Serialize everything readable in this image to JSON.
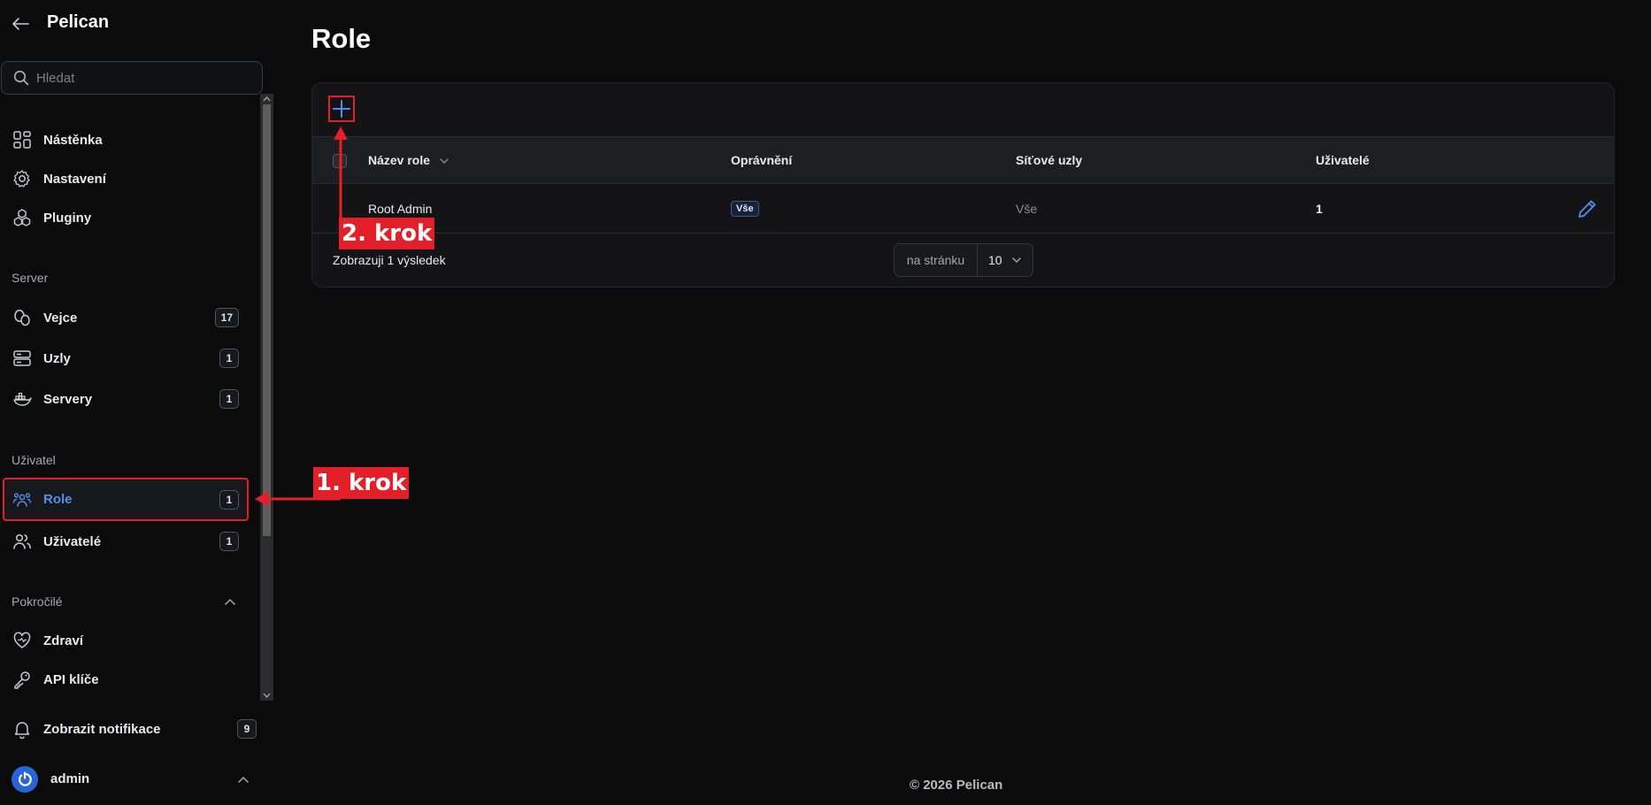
{
  "app": {
    "name": "Pelican"
  },
  "search": {
    "placeholder": "Hledat"
  },
  "nav": {
    "top": [
      {
        "label": "Nástěnka",
        "icon": "dashboard-icon"
      },
      {
        "label": "Nastavení",
        "icon": "gear-icon"
      },
      {
        "label": "Pluginy",
        "icon": "plugins-icon"
      }
    ],
    "server_section": "Server",
    "server": [
      {
        "label": "Vejce",
        "icon": "eggs-icon",
        "badge": "17"
      },
      {
        "label": "Uzly",
        "icon": "server-stack-icon",
        "badge": "1"
      },
      {
        "label": "Servery",
        "icon": "docker-icon",
        "badge": "1"
      }
    ],
    "user_section": "Uživatel",
    "user": [
      {
        "label": "Role",
        "icon": "users-group-icon",
        "badge": "1",
        "active": true
      },
      {
        "label": "Uživatelé",
        "icon": "users-icon",
        "badge": "1"
      }
    ],
    "advanced_section": "Pokročilé",
    "advanced": [
      {
        "label": "Zdraví",
        "icon": "heart-icon"
      },
      {
        "label": "API klíče",
        "icon": "key-icon"
      }
    ],
    "notifications": {
      "label": "Zobrazit notifikace",
      "badge": "9"
    },
    "account": {
      "name": "admin"
    }
  },
  "page": {
    "title": "Role"
  },
  "table": {
    "columns": [
      "Název role",
      "Oprávnění",
      "Síťové uzly",
      "Uživatelé"
    ],
    "rows": [
      {
        "name": "Root Admin",
        "permissions": "Vše",
        "nodes": "Vše",
        "users": "1"
      }
    ],
    "results_text": "Zobrazuji 1 výsledek",
    "per_page_label": "na stránku",
    "per_page_value": "10"
  },
  "footer": {
    "copyright": "© 2026 Pelican"
  },
  "annotations": {
    "step1": "1. krok",
    "step2": "2. krok"
  },
  "colors": {
    "accent": "#4f8ff0",
    "annotation": "#e3202a",
    "background": "#0b0b0c"
  }
}
